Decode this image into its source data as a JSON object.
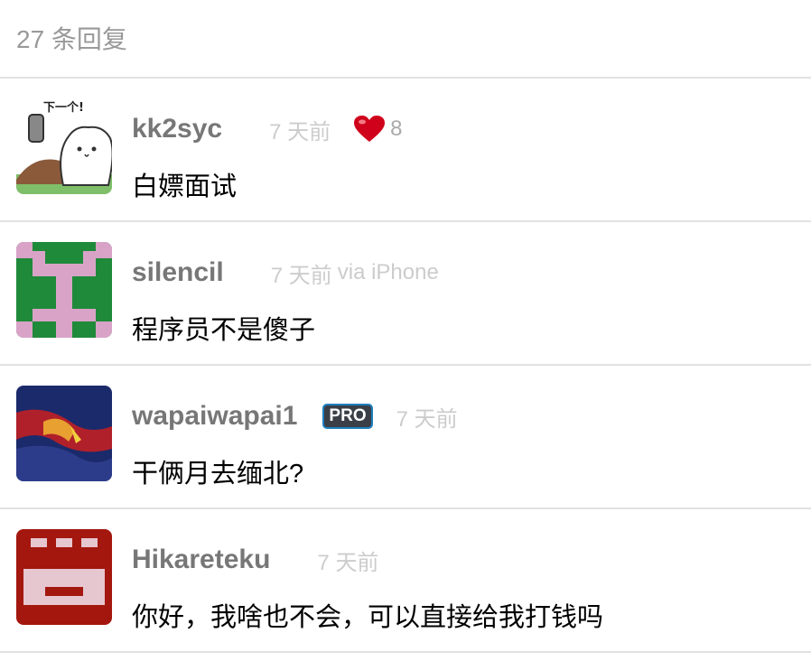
{
  "header": {
    "reply_count": "27 条回复"
  },
  "replies": [
    {
      "username": "kk2syc",
      "time": "7 天前",
      "thanks": "8",
      "content": "白嫖面试",
      "avatar_text": "下一个!"
    },
    {
      "username": "silencil",
      "time": "7 天前",
      "via": "via iPhone",
      "content": "程序员不是傻子"
    },
    {
      "username": "wapaiwapai1",
      "badge": "PRO",
      "time": "7 天前",
      "content": "干俩月去缅北?"
    },
    {
      "username": "Hikareteku",
      "time": "7 天前",
      "content": "你好，我啥也不会，可以直接给我打钱吗"
    }
  ],
  "colors": {
    "username": "#777777",
    "time": "#cccccc",
    "divider": "#e2e2e2",
    "heart": "#d0021b",
    "pro_badge_bg": "#3a3f47",
    "pro_badge_border": "#1f7fbf"
  },
  "icons": {
    "heart": "heart-icon"
  }
}
